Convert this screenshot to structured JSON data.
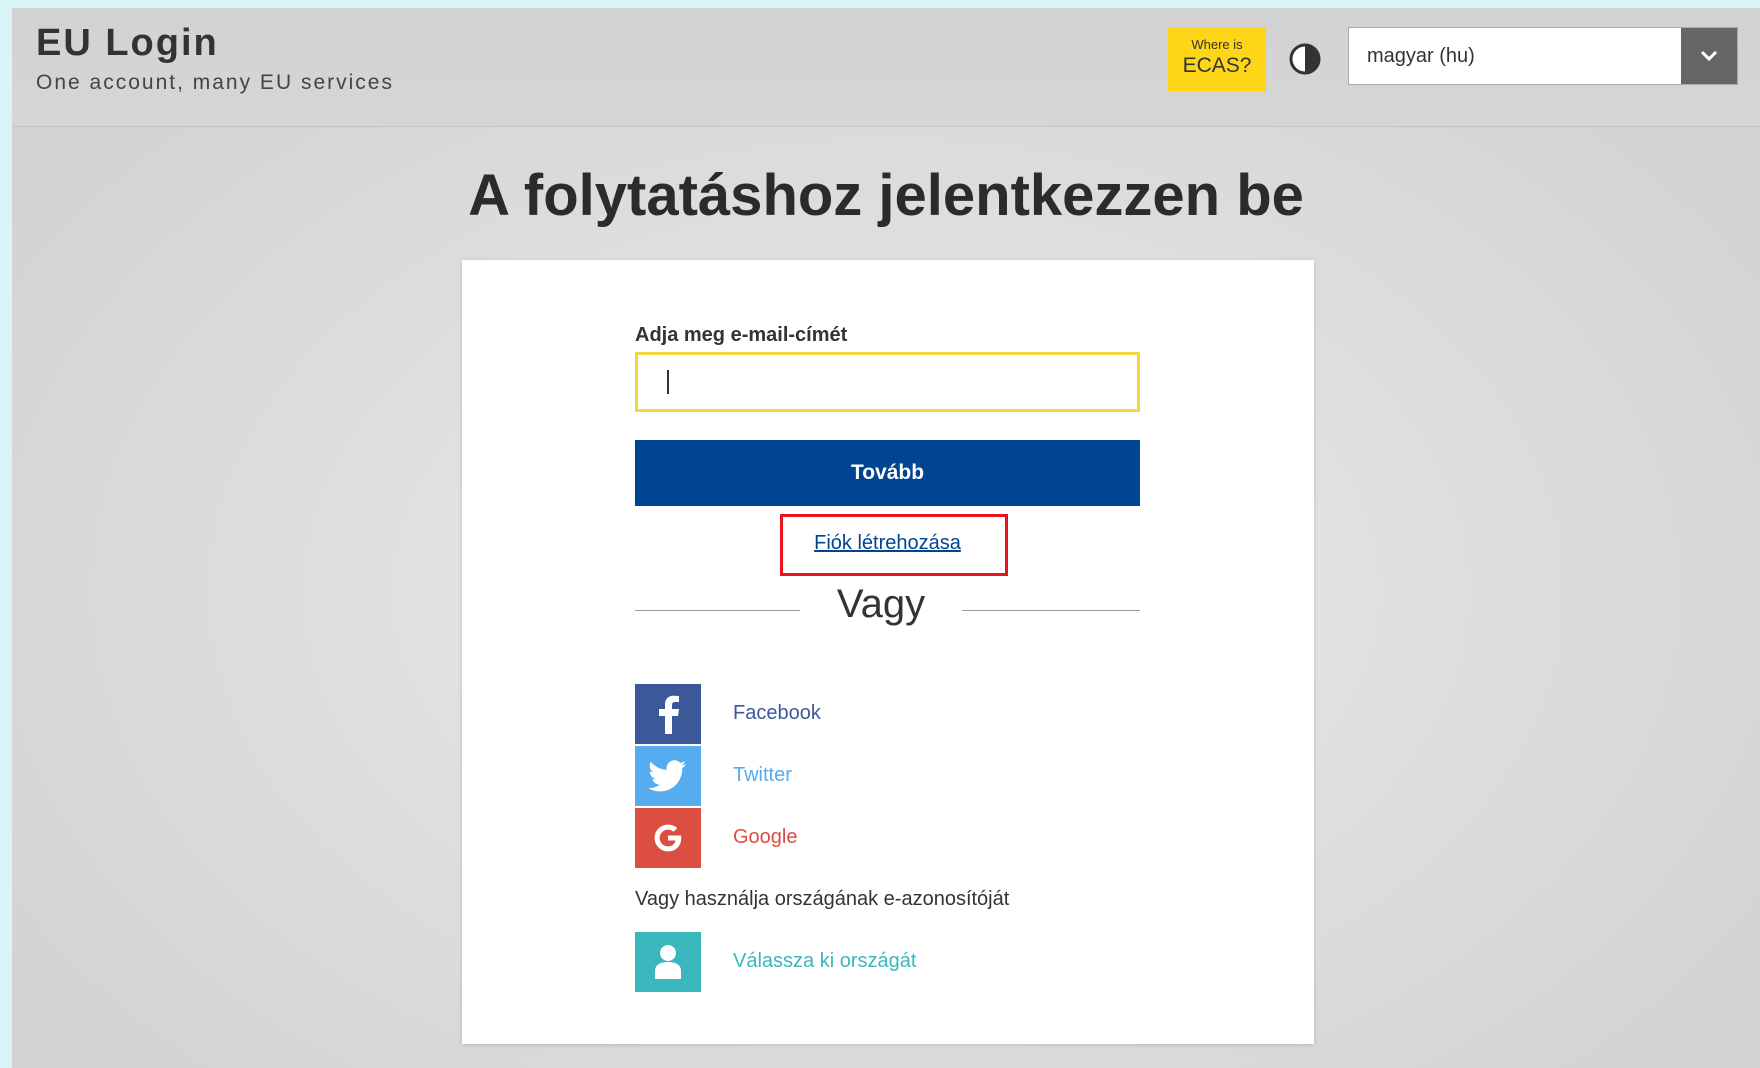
{
  "header": {
    "brand_title": "EU Login",
    "brand_subtitle": "One account, many EU services",
    "ecas_line1": "Where is",
    "ecas_line2": "ECAS?",
    "contrast_icon": "contrast-icon",
    "language_value": "magyar (hu)",
    "language_arrow_icon": "chevron-down-icon"
  },
  "main": {
    "heading": "A folytatáshoz jelentkezzen be"
  },
  "login": {
    "email_label": "Adja meg e-mail-címét",
    "email_value": "",
    "next_label": "Tovább",
    "create_account_label": "Fiók létrehozása",
    "or_label": "Vagy",
    "social": [
      {
        "label": "Facebook",
        "icon": "facebook-icon",
        "color": "#3b5998",
        "text_color": "#3b5998"
      },
      {
        "label": "Twitter",
        "icon": "twitter-icon",
        "color": "#55acee",
        "text_color": "#55acee"
      },
      {
        "label": "Google",
        "icon": "google-icon",
        "color": "#dc4e41",
        "text_color": "#dc4e41"
      }
    ],
    "eid_text": "Vagy használja országának e-azonosítóját",
    "eid_option": {
      "label": "Válassza ki országát",
      "icon": "user-icon",
      "color": "#39b7bd",
      "text_color": "#39b7bd"
    }
  },
  "colors": {
    "primary_button": "#004494",
    "ecas_badge": "#ffd617",
    "input_focus_border": "#f5d53d",
    "highlight_box": "#e8141c"
  }
}
